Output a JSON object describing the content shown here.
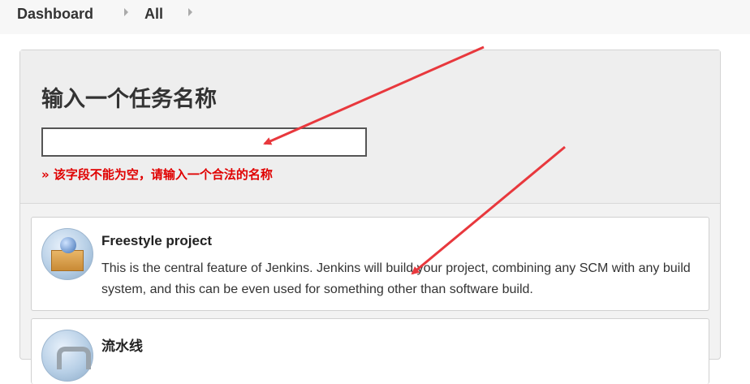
{
  "breadcrumb": {
    "items": [
      "Dashboard",
      "All"
    ]
  },
  "form": {
    "title": "输入一个任务名称",
    "name_value": "",
    "error": "» 该字段不能为空，请输入一个合法的名称"
  },
  "items": [
    {
      "name": "Freestyle project",
      "description": "This is the central feature of Jenkins. Jenkins will build your project, combining any SCM with any build system, and this can be even used for something other than software build.",
      "icon": "freestyle-project-icon"
    },
    {
      "name": "流水线",
      "icon": "pipeline-icon"
    }
  ],
  "annotation": {
    "arrow_color": "#e8383d"
  }
}
